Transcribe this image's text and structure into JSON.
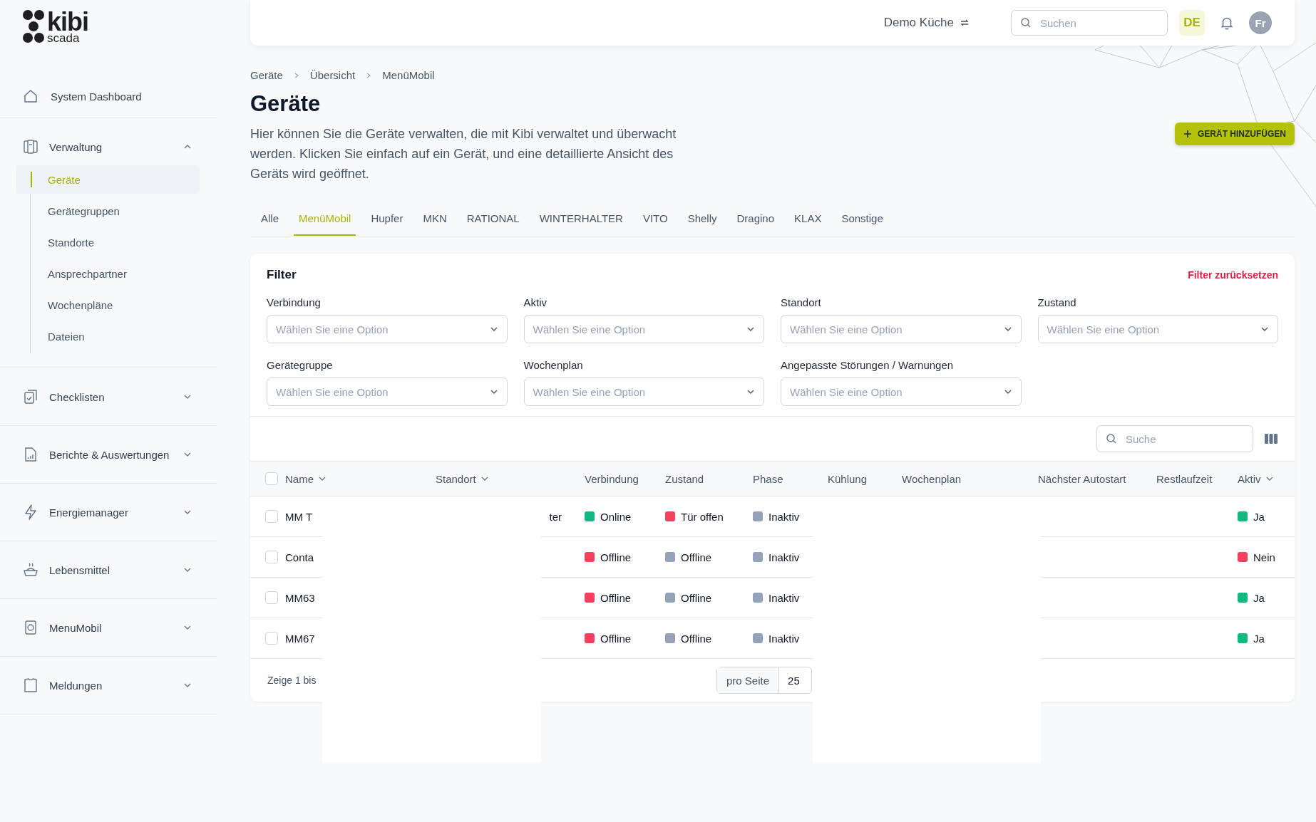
{
  "logo": {
    "name": "kibi",
    "sub": "scada"
  },
  "sidebar": {
    "top_item": {
      "label": "System Dashboard"
    },
    "groups": [
      {
        "label": "Verwaltung",
        "expanded": true,
        "children": [
          {
            "label": "Geräte",
            "selected": true
          },
          {
            "label": "Gerätegruppen",
            "selected": false
          },
          {
            "label": "Standorte",
            "selected": false
          },
          {
            "label": "Ansprechpartner",
            "selected": false
          },
          {
            "label": "Wochenpläne",
            "selected": false
          },
          {
            "label": "Dateien",
            "selected": false
          }
        ]
      },
      {
        "label": "Checklisten",
        "expanded": false
      },
      {
        "label": "Berichte & Auswertungen",
        "expanded": false
      },
      {
        "label": "Energiemanager",
        "expanded": false
      },
      {
        "label": "Lebensmittel",
        "expanded": false
      },
      {
        "label": "MenuMobil",
        "expanded": false
      },
      {
        "label": "Meldungen",
        "expanded": false
      }
    ]
  },
  "topbar": {
    "location": "Demo Küche",
    "search": {
      "placeholder": "Suchen"
    },
    "language": "DE",
    "avatar": "Fr"
  },
  "breadcrumb": [
    "Geräte",
    "Übersicht",
    "MenüMobil"
  ],
  "page": {
    "title": "Geräte",
    "description": "Hier können Sie die Geräte verwalten, die mit Kibi verwaltet und überwacht werden. Klicken Sie einfach auf ein Gerät, und eine detaillierte Ansicht des Geräts wird geöffnet.",
    "add_button": "GERÄT HINZUFÜGEN"
  },
  "tabs": [
    {
      "label": "Alle",
      "selected": false
    },
    {
      "label": "MenüMobil",
      "selected": true
    },
    {
      "label": "Hupfer",
      "selected": false
    },
    {
      "label": "MKN",
      "selected": false
    },
    {
      "label": "RATIONAL",
      "selected": false
    },
    {
      "label": "WINTERHALTER",
      "selected": false
    },
    {
      "label": "VITO",
      "selected": false
    },
    {
      "label": "Shelly",
      "selected": false
    },
    {
      "label": "Dragino",
      "selected": false
    },
    {
      "label": "KLAX",
      "selected": false
    },
    {
      "label": "Sonstige",
      "selected": false
    }
  ],
  "filter": {
    "title": "Filter",
    "reset": "Filter zurücksetzen",
    "fields": [
      {
        "label": "Verbindung",
        "placeholder": "Wählen Sie eine Option"
      },
      {
        "label": "Aktiv",
        "placeholder": "Wählen Sie eine Option"
      },
      {
        "label": "Standort",
        "placeholder": "Wählen Sie eine Option"
      },
      {
        "label": "Zustand",
        "placeholder": "Wählen Sie eine Option"
      },
      {
        "label": "Gerätegruppe",
        "placeholder": "Wählen Sie eine Option"
      },
      {
        "label": "Wochenplan",
        "placeholder": "Wählen Sie eine Option"
      },
      {
        "label": "Angepasste Störungen / Warnungen",
        "placeholder": "Wählen Sie eine Option"
      }
    ]
  },
  "table": {
    "search": {
      "placeholder": "Suche"
    },
    "select_all_checked": false,
    "columns": [
      {
        "label": "Name",
        "sortable": true
      },
      {
        "label": "Standort",
        "sortable": true
      },
      {
        "label": "Verbindung",
        "sortable": false
      },
      {
        "label": "Zustand",
        "sortable": false
      },
      {
        "label": "Phase",
        "sortable": false
      },
      {
        "label": "Kühlung",
        "sortable": false
      },
      {
        "label": "Wochenplan",
        "sortable": false
      },
      {
        "label": "Nächster Autostart",
        "sortable": false
      },
      {
        "label": "Restlaufzeit",
        "sortable": false
      },
      {
        "label": "Aktiv",
        "sortable": true
      }
    ],
    "rows": [
      {
        "checked": false,
        "name": "MM T",
        "standort": "ter",
        "verbindung": {
          "text": "Online",
          "color": "#10b981"
        },
        "zustand": {
          "text": "Tür offen",
          "color": "#f43f5e"
        },
        "phase": {
          "text": "Inaktiv",
          "color": "#94a3b8"
        },
        "aktiv": {
          "text": "Ja",
          "color": "#10b981"
        }
      },
      {
        "checked": false,
        "name": "Conta",
        "verbindung": {
          "text": "Offline",
          "color": "#f43f5e"
        },
        "zustand": {
          "text": "Offline",
          "color": "#94a3b8"
        },
        "phase": {
          "text": "Inaktiv",
          "color": "#94a3b8"
        },
        "aktiv": {
          "text": "Nein",
          "color": "#f43f5e"
        }
      },
      {
        "checked": false,
        "name": "MM63",
        "verbindung": {
          "text": "Offline",
          "color": "#f43f5e"
        },
        "zustand": {
          "text": "Offline",
          "color": "#94a3b8"
        },
        "phase": {
          "text": "Inaktiv",
          "color": "#94a3b8"
        },
        "aktiv": {
          "text": "Ja",
          "color": "#10b981"
        }
      },
      {
        "checked": false,
        "name": "MM67",
        "verbindung": {
          "text": "Offline",
          "color": "#f43f5e"
        },
        "zustand": {
          "text": "Offline",
          "color": "#94a3b8"
        },
        "phase": {
          "text": "Inaktiv",
          "color": "#94a3b8"
        },
        "aktiv": {
          "text": "Ja",
          "color": "#10b981"
        }
      }
    ],
    "footer": {
      "summary": "Zeige 1 bis",
      "per_page_label": "pro Seite",
      "per_page": "25"
    }
  }
}
